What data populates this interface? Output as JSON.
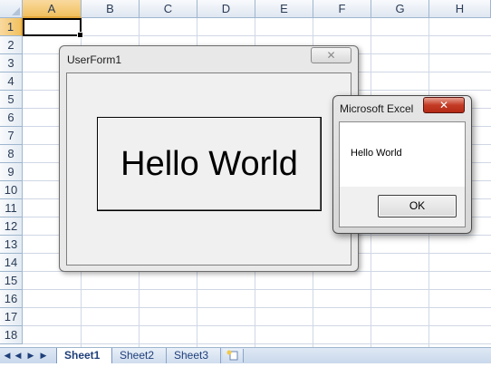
{
  "spreadsheet": {
    "columns": [
      "A",
      "B",
      "C",
      "D",
      "E",
      "F",
      "G",
      "H"
    ],
    "rows": [
      "1",
      "2",
      "3",
      "4",
      "5",
      "6",
      "7",
      "8",
      "9",
      "10",
      "11",
      "12",
      "13",
      "14",
      "15",
      "16",
      "17",
      "18"
    ],
    "selected_column": "A",
    "selected_row": "1",
    "active_cell": "A1"
  },
  "sheet_tabs": {
    "tabs": [
      "Sheet1",
      "Sheet2",
      "Sheet3"
    ],
    "active_tab": "Sheet1",
    "nav_buttons": [
      "first-sheet",
      "previous-sheet",
      "next-sheet",
      "last-sheet"
    ]
  },
  "userform": {
    "title": "UserForm1",
    "close_label": "✕",
    "button_label": "Hello World"
  },
  "msgbox": {
    "title": "Microsoft Excel",
    "close_label": "✕",
    "message": "Hello World",
    "ok_label": "OK"
  },
  "colors": {
    "header_selected": "#f1c15f",
    "grid_line": "#d0d7e5",
    "close_red": "#c43b25"
  }
}
